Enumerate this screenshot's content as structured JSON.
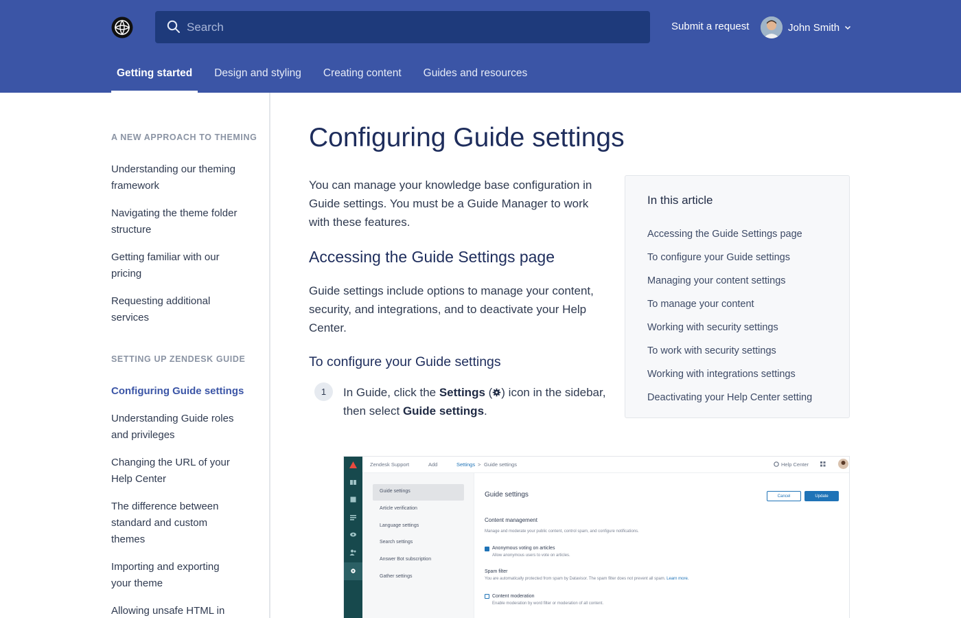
{
  "header": {
    "search_placeholder": "Search",
    "submit_request": "Submit a request",
    "user_name": "John Smith",
    "nav_tabs": [
      {
        "label": "Getting started",
        "active": true
      },
      {
        "label": "Design and styling",
        "active": false
      },
      {
        "label": "Creating content",
        "active": false
      },
      {
        "label": "Guides and resources",
        "active": false
      }
    ]
  },
  "sidebar": {
    "sections": [
      {
        "title": "A NEW APPROACH TO THEMING",
        "items": [
          "Understanding our theming framework",
          "Navigating the theme folder structure",
          "Getting familiar with our pricing",
          "Requesting additional services"
        ]
      },
      {
        "title": "SETTING UP ZENDESK GUIDE",
        "items": [
          "Configuring Guide settings",
          "Understanding Guide roles and privileges",
          "Changing the URL of your Help Center",
          "The difference between standard and custom themes",
          "Importing and exporting your theme",
          "Allowing unsafe HTML in"
        ]
      }
    ]
  },
  "article": {
    "title": "Configuring Guide settings",
    "intro": "You can manage your knowledge base configuration in Guide settings. You must be a Guide Manager to work with these features.",
    "h2": "Accessing the Guide Settings page",
    "para2": "Guide settings include options to manage your content, security, and integrations, and to deactivate your Help Center.",
    "h3": "To configure your Guide settings",
    "step": {
      "number": "1",
      "pre": "In Guide, click the ",
      "settings_bold": "Settings",
      "open_paren": " (",
      "mid": ") icon in the sidebar, then select ",
      "guide_settings_bold": "Guide settings",
      "end": "."
    }
  },
  "toc": {
    "title": "In this article",
    "items": [
      "Accessing the Guide Settings page",
      "To configure your Guide settings",
      "Managing your content settings",
      "To manage your content",
      "Working with security settings",
      "To work with security settings",
      "Working with integrations settings",
      "Deactivating your Help Center setting"
    ]
  },
  "screenshot": {
    "top": {
      "product": "Zendesk Support",
      "add": "Add",
      "crumb_settings": "Settings",
      "crumb_sep": ">",
      "crumb_current": "Guide settings",
      "help_center": "Help Center"
    },
    "menu": [
      "Guide settings",
      "Article verification",
      "Language settings",
      "Search settings",
      "Answer Bot subscription",
      "Gather settings"
    ],
    "content": {
      "title": "Guide settings",
      "cancel": "Cancel",
      "update": "Update",
      "section_title": "Content management",
      "section_desc": "Manage and moderate your public content, control spam, and configure notifications.",
      "opt1_title": "Anonymous voting on articles",
      "opt1_desc": "Allow anonymous users to vote on articles.",
      "spam_title": "Spam filter",
      "spam_desc": "You are automatically protected from spam by Datavisor. The spam filter does not prevent all spam.",
      "learn_more": "Learn more.",
      "opt2_title": "Content moderation",
      "opt2_desc": "Enable moderation by word filter or moderation of all content."
    },
    "colors": {
      "rail": "#17494d",
      "accent": "#1f73b7"
    }
  },
  "colors": {
    "header_bg": "#3b55a6",
    "search_bg": "#1e3a7b",
    "title": "#1e2d5c",
    "active_link": "#3b55a6"
  }
}
